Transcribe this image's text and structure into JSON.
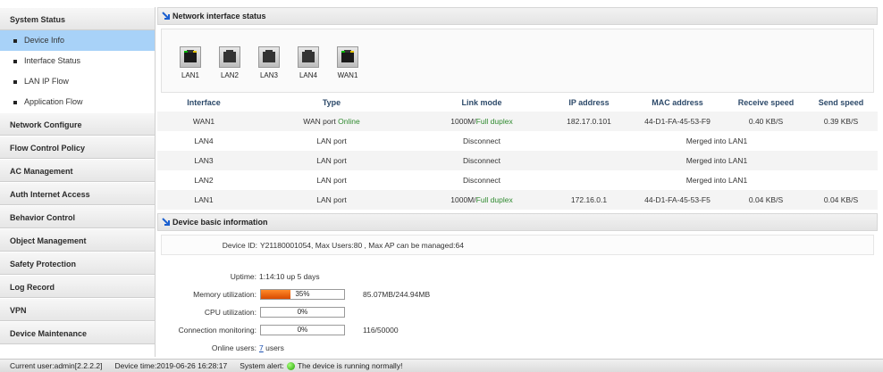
{
  "sidebar": {
    "system_status": "System Status",
    "sub_items": [
      "Device Info",
      "Interface Status",
      "LAN IP Flow",
      "Application Flow"
    ],
    "sections": [
      "Network Configure",
      "Flow Control Policy",
      "AC Management",
      "Auth Internet Access",
      "Behavior Control",
      "Object Management",
      "Safety Protection",
      "Log Record",
      "VPN",
      "Device Maintenance"
    ]
  },
  "network": {
    "title": "Network interface status",
    "ports": [
      "LAN1",
      "LAN2",
      "LAN3",
      "LAN4",
      "WAN1"
    ],
    "columns": [
      "Interface",
      "Type",
      "Link mode",
      "IP address",
      "MAC address",
      "Receive speed",
      "Send speed"
    ],
    "rows": [
      {
        "iface": "WAN1",
        "type": "WAN port ",
        "type_status": "Online",
        "link": "1000M/",
        "link_duplex": "Full duplex",
        "ip": "182.17.0.101",
        "mac": "44-D1-FA-45-53-F9",
        "rx": "0.40 KB/S",
        "tx": "0.39 KB/S"
      },
      {
        "iface": "LAN4",
        "type": "LAN port",
        "type_status": "",
        "link": "Disconnect",
        "link_duplex": "",
        "merged": "Merged into LAN1"
      },
      {
        "iface": "LAN3",
        "type": "LAN port",
        "type_status": "",
        "link": "Disconnect",
        "link_duplex": "",
        "merged": "Merged into LAN1"
      },
      {
        "iface": "LAN2",
        "type": "LAN port",
        "type_status": "",
        "link": "Disconnect",
        "link_duplex": "",
        "merged": "Merged into LAN1"
      },
      {
        "iface": "LAN1",
        "type": "LAN port",
        "type_status": "",
        "link": "1000M/",
        "link_duplex": "Full duplex",
        "ip": "172.16.0.1",
        "mac": "44-D1-FA-45-53-F5",
        "rx": "0.04 KB/S",
        "tx": "0.04 KB/S"
      }
    ]
  },
  "device": {
    "title": "Device basic information",
    "device_id_label": "Device ID:",
    "device_id_value": "Y21180001054, Max Users:80 , Max AP can be managed:64",
    "uptime_label": "Uptime:",
    "uptime_value": "1:14:10 up 5 days",
    "memory_label": "Memory utilization:",
    "memory_pct": "35%",
    "memory_fraction": 0.35,
    "memory_note": "85.07MB/244.94MB",
    "cpu_label": "CPU utilization:",
    "cpu_pct": "0%",
    "cpu_fraction": 0,
    "conn_label": "Connection monitoring:",
    "conn_pct": "0%",
    "conn_fraction": 0,
    "conn_note": "116/50000",
    "online_label": "Online users:",
    "online_count": "7",
    "online_suffix": " users"
  },
  "status_bar": {
    "current_user": "Current user:admin[2.2.2.2]",
    "device_time": "Device time:2019-06-26 16:28:17",
    "alert_label": "System alert:",
    "alert_text": "The device is running normally!"
  },
  "colors": {
    "active_item": "#a8d2f8",
    "progress": "#e65c00",
    "status_ok": "#2f8a2f"
  }
}
